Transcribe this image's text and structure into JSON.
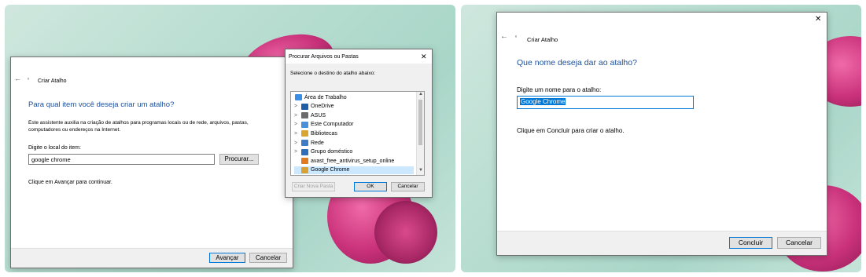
{
  "left_wizard": {
    "title": "Criar Atalho",
    "heading": "Para qual item você deseja criar um atalho?",
    "description_line1": "Este assistente auxilia na criação de atalhos para programas locais ou de rede, arquivos, pastas,",
    "description_line2": "computadores ou endereços na Internet.",
    "location_label": "Digite o local do item:",
    "location_value": "google chrome",
    "browse_button": "Procurar...",
    "continue_hint": "Clique em Avançar para continuar.",
    "next_button": "Avançar",
    "cancel_button": "Cancelar"
  },
  "browse_dialog": {
    "title": "Procurar Arquivos ou Pastas",
    "close": "✕",
    "instruction": "Selecione o destino do atalho abaixo:",
    "tree": [
      {
        "label": "Área de Trabalho",
        "icon": "desktop-icon",
        "color": "#3a8ee6",
        "chevron": ""
      },
      {
        "label": "OneDrive",
        "icon": "onedrive-icon",
        "color": "#1f5fa8",
        "chevron": ">"
      },
      {
        "label": "ASUS",
        "icon": "user-icon",
        "color": "#6b6b6b",
        "chevron": ">"
      },
      {
        "label": "Este Computador",
        "icon": "computer-icon",
        "color": "#4a90d9",
        "chevron": ">"
      },
      {
        "label": "Bibliotecas",
        "icon": "library-icon",
        "color": "#d8a531",
        "chevron": ">"
      },
      {
        "label": "Rede",
        "icon": "network-icon",
        "color": "#3f7cc4",
        "chevron": ">"
      },
      {
        "label": "Grupo doméstico",
        "icon": "homegroup-icon",
        "color": "#2f6fb9",
        "chevron": ">"
      },
      {
        "label": "avast_free_antivirus_setup_online",
        "icon": "installer-icon",
        "color": "#e07b24",
        "chevron": ""
      },
      {
        "label": "Google Chrome",
        "icon": "shortcut-icon",
        "color": "#d9a033",
        "chevron": ""
      }
    ],
    "new_folder_button": "Criar Nova Pasta",
    "ok_button": "OK",
    "cancel_button": "Cancelar"
  },
  "right_wizard": {
    "close": "✕",
    "title": "Criar Atalho",
    "heading": "Que nome deseja dar ao atalho?",
    "name_label": "Digite um nome para o atalho:",
    "name_value": "Google Chrome",
    "finish_hint": "Clique em Concluir para criar o atalho.",
    "finish_button": "Concluir",
    "cancel_button": "Cancelar"
  },
  "icons": {
    "back": "←",
    "wizard": "shortcut-wizard-icon"
  },
  "colors": {
    "accent_blue": "#1a4f9e",
    "selection": "#cce8ff",
    "focus": "#0078d7"
  }
}
